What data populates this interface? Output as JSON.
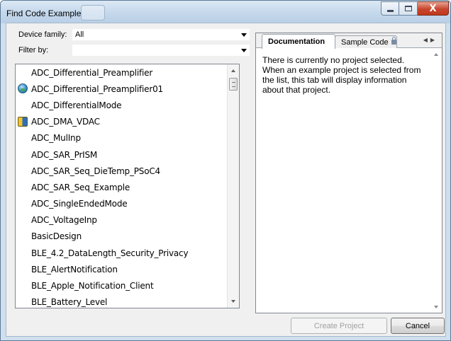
{
  "window": {
    "title": "Find Code Example",
    "close_glyph": "X"
  },
  "filters": {
    "device_family_label": "Device family:",
    "device_family_value": "All",
    "filter_by_label": "Filter by:",
    "filter_by_value": ""
  },
  "examples": [
    {
      "name": "ADC_Differential_Preamplifier",
      "icon": null
    },
    {
      "name": "ADC_Differential_Preamplifier01",
      "icon": "globe-icon"
    },
    {
      "name": "ADC_DifferentialMode",
      "icon": null
    },
    {
      "name": "ADC_DMA_VDAC",
      "icon": "pc-icon"
    },
    {
      "name": "ADC_MulInp",
      "icon": null
    },
    {
      "name": "ADC_SAR_PrISM",
      "icon": null
    },
    {
      "name": "ADC_SAR_Seq_DieTemp_PSoC4",
      "icon": null
    },
    {
      "name": "ADC_SAR_Seq_Example",
      "icon": null
    },
    {
      "name": "ADC_SingleEndedMode",
      "icon": null
    },
    {
      "name": "ADC_VoltageInp",
      "icon": null
    },
    {
      "name": "BasicDesign",
      "icon": null
    },
    {
      "name": "BLE_4.2_DataLength_Security_Privacy",
      "icon": null
    },
    {
      "name": "BLE_AlertNotification",
      "icon": null
    },
    {
      "name": "BLE_Apple_Notification_Client",
      "icon": null
    },
    {
      "name": "BLE_Battery_Level",
      "icon": null
    }
  ],
  "tabs": {
    "documentation": "Documentation",
    "sample_code": "Sample Code"
  },
  "documentation_text": "There is currently no project selected. When an example project is selected from the list, this tab will display information about that project.",
  "buttons": {
    "create_project": "Create Project",
    "cancel": "Cancel"
  },
  "colors": {
    "title_bar": "#c6d9ec",
    "close_button": "#c7452c",
    "dialog_background": "#f0f0f0"
  }
}
